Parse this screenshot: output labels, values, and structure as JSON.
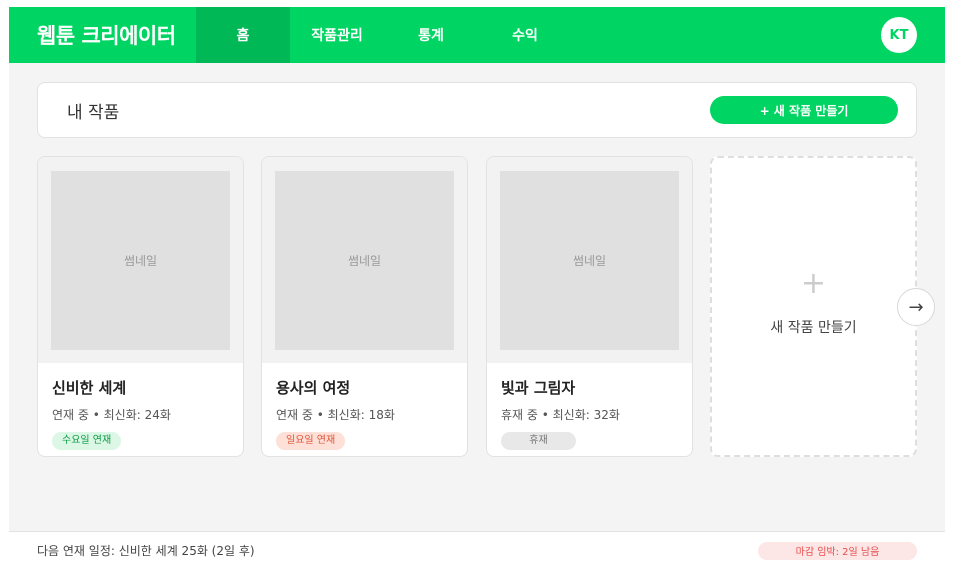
{
  "colors": {
    "brand": "#00d563",
    "nav_active": "#00b856",
    "tag_green_bg": "#dcf7e6",
    "tag_green_fg": "#0a9d44",
    "tag_red_bg": "#fde0d8",
    "tag_red_fg": "#e2553a",
    "tag_gray_bg": "#e8e8e8",
    "tag_gray_fg": "#777777",
    "deadline_bg": "#fde6e6",
    "deadline_fg": "#e84c4c"
  },
  "header": {
    "logo": "웹툰 크리에이터",
    "nav": [
      {
        "label": "홈",
        "active": true
      },
      {
        "label": "작품관리",
        "active": false
      },
      {
        "label": "통계",
        "active": false
      },
      {
        "label": "수익",
        "active": false
      }
    ],
    "avatar": "KT"
  },
  "titlebar": {
    "title": "내 작품",
    "new_button": "+ 새 작품 만들기"
  },
  "cards": [
    {
      "thumbnail": "썸네일",
      "title": "신비한 세계",
      "meta": "연재 중 • 최신화: 24화",
      "tag": "수요일 연재",
      "tag_style": "green"
    },
    {
      "thumbnail": "썸네일",
      "title": "용사의 여정",
      "meta": "연재 중 • 최신화: 18화",
      "tag": "일요일 연재",
      "tag_style": "red"
    },
    {
      "thumbnail": "썸네일",
      "title": "빛과 그림자",
      "meta": "휴재 중 • 최신화: 32화",
      "tag": "휴재",
      "tag_style": "gray"
    }
  ],
  "new_card": {
    "icon": "plus-icon",
    "plus": "+",
    "label": "새 작품 만들기"
  },
  "next_button": {
    "icon": "arrow-right-icon",
    "glyph": "→"
  },
  "footer": {
    "schedule": "다음 연재 일정: 신비한 세계 25화 (2일 후)",
    "deadline": "마감 임박: 2일 남음"
  }
}
